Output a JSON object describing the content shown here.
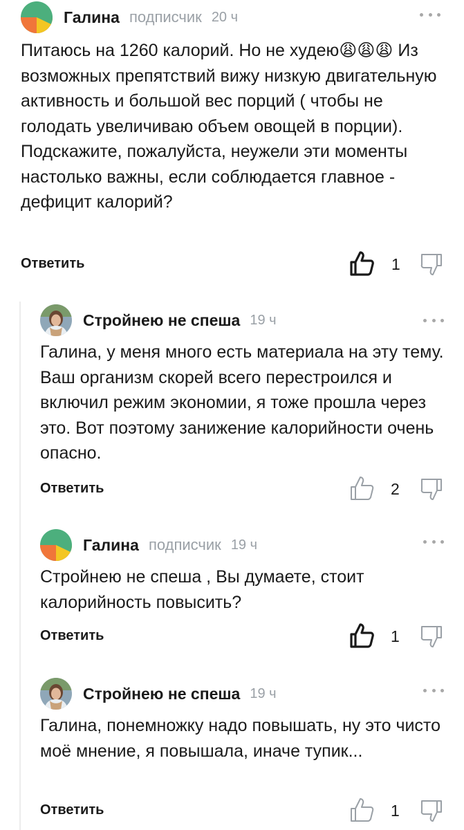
{
  "comments": [
    {
      "author": "Галина",
      "role": "подписчик",
      "time": "20 ч",
      "text": "Питаюсь на 1260 калорий. Но не худею😩😩😩 Из возможных препятствий вижу низкую двигательную активность и большой вес порций ( чтобы не голодать увеличиваю объем овощей в порции). Подскажите, пожалуйста, неужели эти моменты настолько важны, если соблюдается главное - дефицит калорий?",
      "reply_label": "Ответить",
      "likes": "1",
      "liked": true,
      "avatar": "pie-avatar"
    },
    {
      "author": "Стройнею не спеша",
      "role": "",
      "time": "19 ч",
      "text": "Галина, у меня много есть материала на эту тему. Ваш организм скорей всего перестроился и включил режим экономии, я тоже прошла через это. Вот поэтому занижение калорийности очень опасно.",
      "reply_label": "Ответить",
      "likes": "2",
      "liked": false,
      "avatar": "photo-avatar"
    },
    {
      "author": "Галина",
      "role": "подписчик",
      "time": "19 ч",
      "text": "Стройнею не спеша , Вы думаете, стоит калорийность повысить?",
      "reply_label": "Ответить",
      "likes": "1",
      "liked": true,
      "avatar": "pie-avatar"
    },
    {
      "author": "Стройнею не спеша",
      "role": "",
      "time": "19 ч",
      "text": "Галина, понемножку надо повышать, ну это чисто моё мнение, я повышала, иначе тупик...",
      "reply_label": "Ответить",
      "likes": "1",
      "liked": false,
      "avatar": "photo-avatar"
    }
  ],
  "colors": {
    "pie_green": "#4caf7d",
    "pie_orange": "#f0763a",
    "pie_yellow": "#f3c623",
    "muted": "#9aa0a6",
    "thread_line": "#ececec"
  }
}
